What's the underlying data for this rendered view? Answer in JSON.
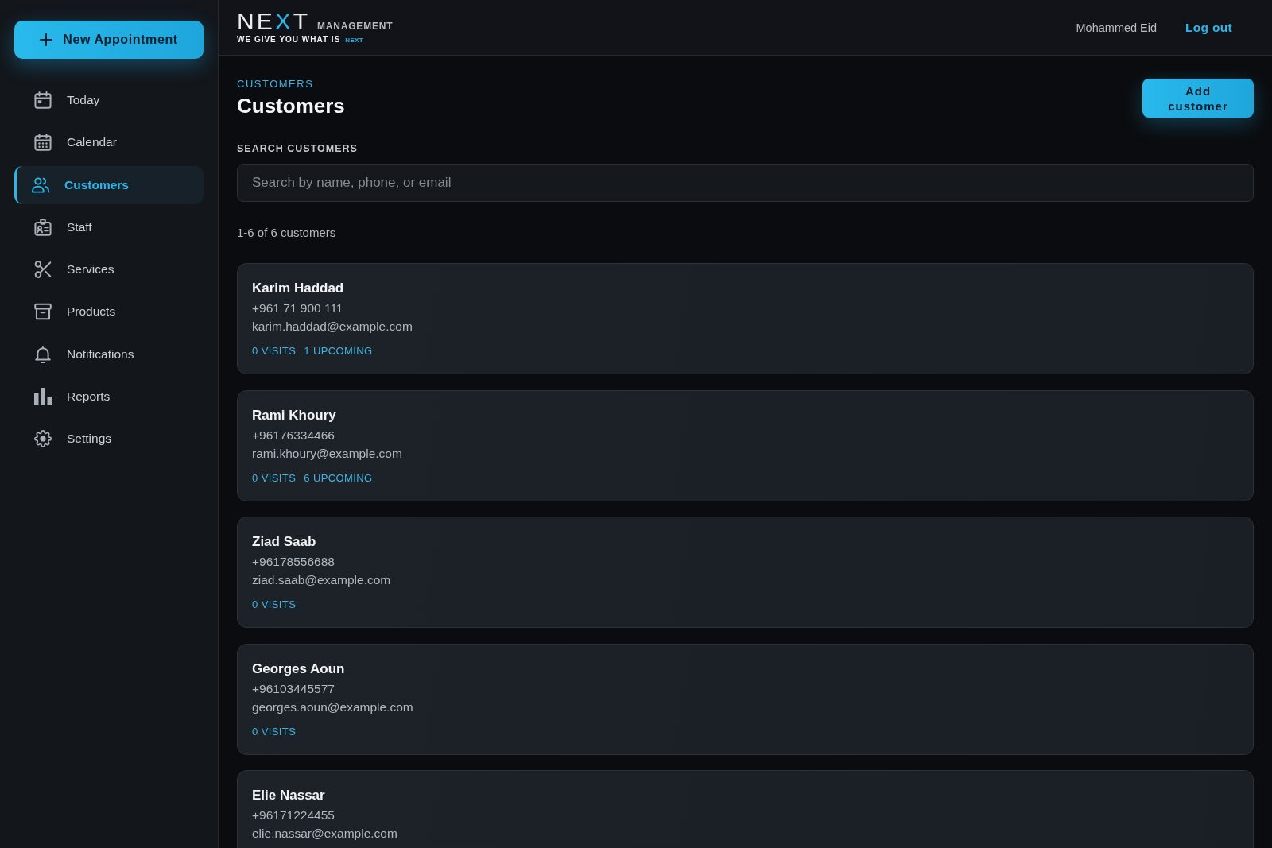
{
  "sidebar": {
    "primary_button": {
      "label": "New Appointment"
    },
    "items": [
      {
        "label": "Today",
        "selected": false
      },
      {
        "label": "Calendar",
        "selected": false
      },
      {
        "label": "Customers",
        "selected": true
      },
      {
        "label": "Staff",
        "selected": false
      },
      {
        "label": "Services",
        "selected": false
      },
      {
        "label": "Products",
        "selected": false
      },
      {
        "label": "Notifications",
        "selected": false
      },
      {
        "label": "Reports",
        "selected": false
      },
      {
        "label": "Settings",
        "selected": false
      }
    ]
  },
  "header": {
    "logo": {
      "wordmark": [
        {
          "text": "NE",
          "accent": false
        },
        {
          "text": "X",
          "accent": true
        },
        {
          "text": "T",
          "accent": false
        }
      ],
      "subtitle": "MANAGEMENT",
      "tagline": "WE GIVE YOU WHAT IS",
      "tagline_accent": "NEXT"
    },
    "user_name": "Mohammed Eid",
    "logout": "Log out"
  },
  "page": {
    "breadcrumb": "CUSTOMERS",
    "title": "Customers",
    "add_button": "Add customer",
    "search": {
      "label": "SEARCH CUSTOMERS",
      "placeholder": "Search by name, phone, or email"
    },
    "count": "1-6 of 6 customers",
    "customers": [
      {
        "name": "Karim Haddad",
        "phone": "+961 71 900 111",
        "email": "karim.haddad@example.com",
        "stats": [
          "0 VISITS",
          "1 UPCOMING"
        ]
      },
      {
        "name": "Rami Khoury",
        "phone": "+96176334466",
        "email": "rami.khoury@example.com",
        "stats": [
          "0 VISITS",
          "6 UPCOMING"
        ]
      },
      {
        "name": "Ziad Saab",
        "phone": "+96178556688",
        "email": "ziad.saab@example.com",
        "stats": [
          "0 VISITS"
        ]
      },
      {
        "name": "Georges Aoun",
        "phone": "+96103445577",
        "email": "georges.aoun@example.com",
        "stats": [
          "0 VISITS"
        ]
      },
      {
        "name": "Elie Nassar",
        "phone": "+96171224455",
        "email": "elie.nassar@example.com"
      }
    ]
  }
}
